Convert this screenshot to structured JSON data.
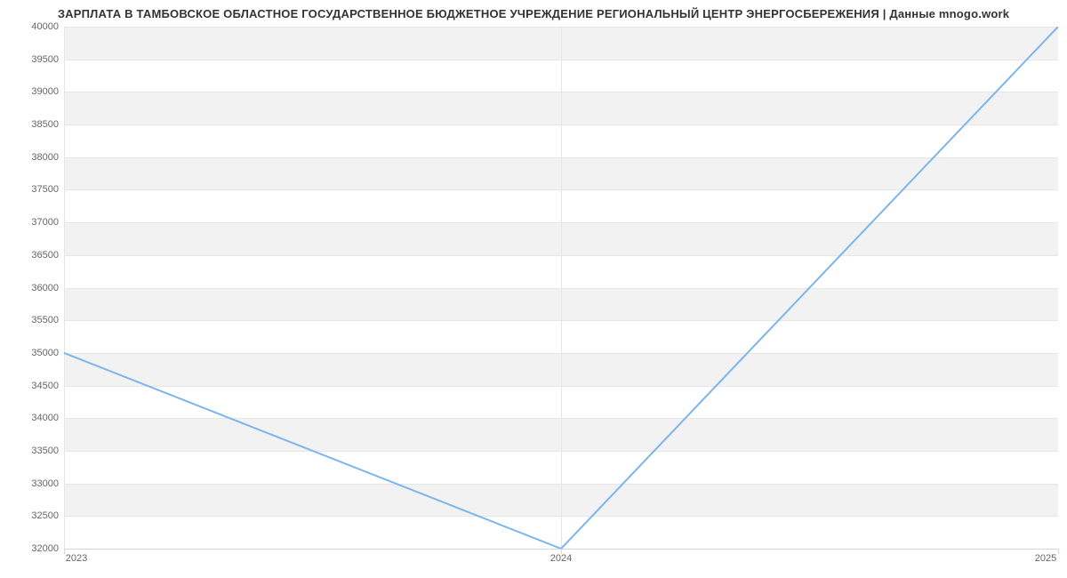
{
  "chart_data": {
    "type": "line",
    "title": "ЗАРПЛАТА В ТАМБОВСКОЕ ОБЛАСТНОЕ ГОСУДАРСТВЕННОЕ БЮДЖЕТНОЕ УЧРЕЖДЕНИЕ РЕГИОНАЛЬНЫЙ ЦЕНТР ЭНЕРГОСБЕРЕЖЕНИЯ | Данные mnogo.work",
    "x": [
      "2023",
      "2024",
      "2025"
    ],
    "values": [
      35000,
      32000,
      40000
    ],
    "y_ticks": [
      32000,
      32500,
      33000,
      33500,
      34000,
      34500,
      35000,
      35500,
      36000,
      36500,
      37000,
      37500,
      38000,
      38500,
      39000,
      39500,
      40000
    ],
    "x_ticks": [
      "2023",
      "2024",
      "2025"
    ],
    "ylim": [
      32000,
      40000
    ],
    "xlabel": "",
    "ylabel": "",
    "series_color": "#7cb5ec"
  }
}
